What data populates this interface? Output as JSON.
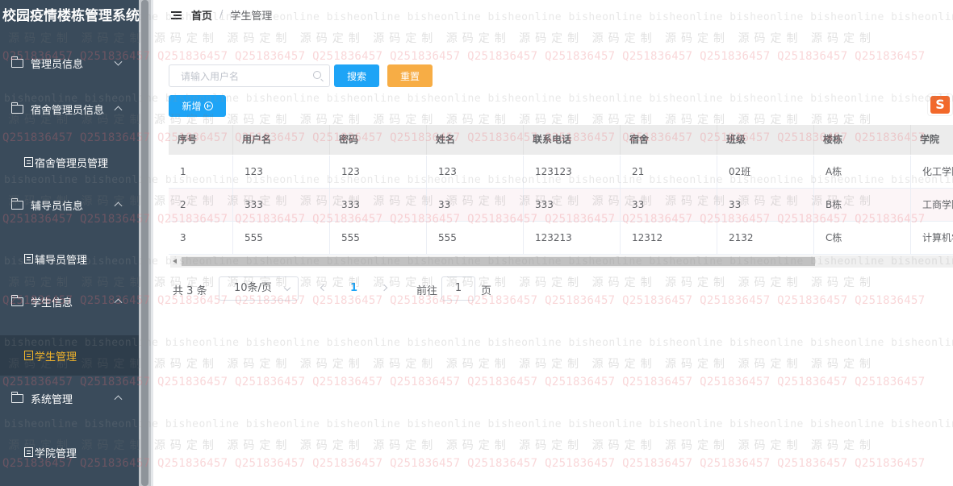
{
  "sidebar": {
    "brand": "校园疫情楼栋管理系统",
    "groups": [
      {
        "label": "管理员信息",
        "expanded": false,
        "items": []
      },
      {
        "label": "宿舍管理员信息",
        "expanded": true,
        "items": [
          "宿舍管理员管理"
        ]
      },
      {
        "label": "辅导员信息",
        "expanded": true,
        "items": [
          "辅导员管理"
        ]
      },
      {
        "label": "学生信息",
        "expanded": true,
        "items": [
          "学生管理"
        ]
      },
      {
        "label": "系统管理",
        "expanded": true,
        "items": [
          "学院管理"
        ]
      }
    ],
    "active_item": "学生管理"
  },
  "breadcrumb": {
    "home": "首页",
    "separator": "/",
    "current": "学生管理"
  },
  "toolbar": {
    "search_placeholder": "请输入用户名",
    "search_label": "搜索",
    "reset_label": "重置",
    "add_label": "新增"
  },
  "table": {
    "columns": [
      "序号",
      "用户名",
      "密码",
      "姓名",
      "联系电话",
      "宿舍",
      "班级",
      "楼栋",
      "学院"
    ],
    "rows": [
      [
        "1",
        "123",
        "123",
        "123",
        "123123",
        "21",
        "02班",
        "A栋",
        "化工学院"
      ],
      [
        "2",
        "333",
        "333",
        "33",
        "333",
        "33",
        "33",
        "B栋",
        "工商学院"
      ],
      [
        "3",
        "555",
        "555",
        "555",
        "123213",
        "12312",
        "2132",
        "C栋",
        "计算机学院"
      ]
    ]
  },
  "pagination": {
    "total_text": "共 3 条",
    "page_size": "10条/页",
    "current_page": "1",
    "goto_label": "前往",
    "goto_value": "1",
    "page_suffix": "页"
  },
  "watermark": {
    "text_a": "bisheonline",
    "text_b": "源码定制",
    "text_c": "Q2518364 57"
  },
  "logo": {
    "letter": "S"
  },
  "colors": {
    "sidebar_bg": "#3a4b5b",
    "primary": "#1ea4f6",
    "warning": "#f7ad45",
    "active_text": "#f3b52a"
  }
}
